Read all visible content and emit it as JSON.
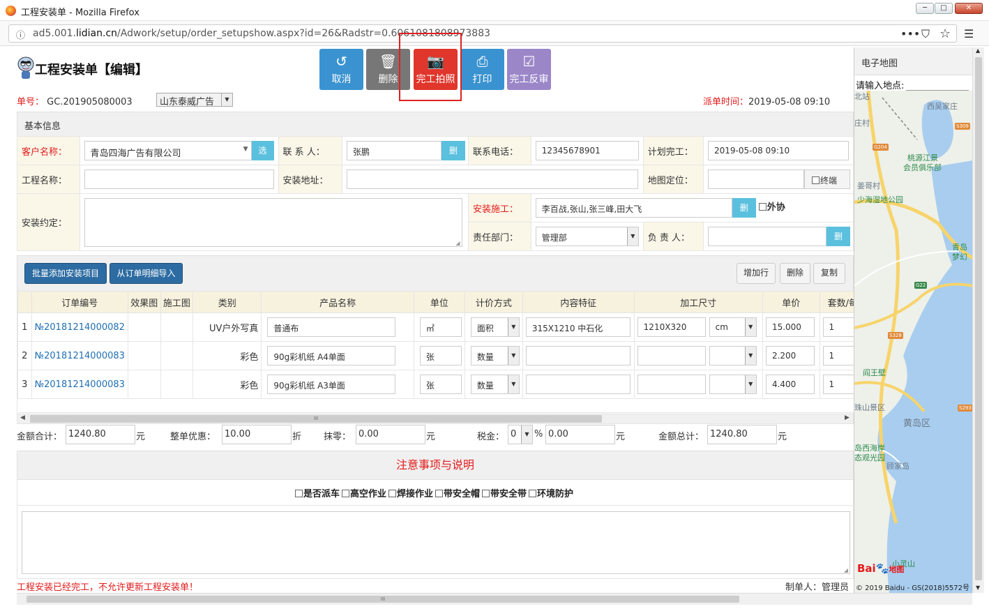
{
  "window": {
    "title": "工程安装单 - Mozilla Firefox",
    "url_prefix": "ad5.001.",
    "url_domain": "lidian.cn",
    "url_path": "/Adwork/setup/order_setupshow.aspx?id=26&Radstr=0.6061081808973883",
    "min_label": "─",
    "max_label": "□",
    "close_label": "✕",
    "menu_dots": "•••",
    "star": "☆",
    "hamburger": "☰",
    "pocket": "⛉"
  },
  "header": {
    "title": "工程安装单【编辑】",
    "order_label": "单号：",
    "order_no": "GC.201905080003",
    "company": "山东泰威广告",
    "dispatch_label": "派单时间：",
    "dispatch_time": "2019-05-08 09:10"
  },
  "toolbar": [
    {
      "label": "取消",
      "icon": "undo-icon",
      "glyph": "↺",
      "color": "#3a93d0"
    },
    {
      "label": "删除",
      "icon": "trash-icon",
      "glyph": "🗑",
      "color": "#777777"
    },
    {
      "label": "完工拍照",
      "icon": "camera-icon",
      "glyph": "📷",
      "color": "#e0362b"
    },
    {
      "label": "打印",
      "icon": "printer-icon",
      "glyph": "⎙",
      "color": "#3a93d0"
    },
    {
      "label": "完工反审",
      "icon": "check-square-icon",
      "glyph": "☑",
      "color": "#9b86c8"
    }
  ],
  "basic": {
    "section_title": "基本信息",
    "customer_label": "客户名称：",
    "customer_value": "青岛四海广告有限公司",
    "select_button": "选",
    "contact_label": "联 系 人：",
    "contact_value": "张鹏",
    "delete_button": "删",
    "phone_label": "联系电话：",
    "phone_value": "12345678901",
    "plan_label": "计划完工：",
    "plan_value": "2019-05-08 09:10",
    "project_label": "工程名称：",
    "project_value": "",
    "address_label": "安装地址：",
    "address_value": "",
    "geo_label": "地图定位：",
    "geo_value": "",
    "terminal_label": "终端",
    "agreement_label": "安装约定：",
    "installer_label": "安装施工：",
    "installer_value": "李百战,张山,张三峰,田大飞",
    "outsource_label": "外协",
    "dept_label": "责任部门：",
    "dept_value": "管理部",
    "owner_label": "负 责 人：",
    "owner_value": ""
  },
  "items": {
    "batch_button": "批量添加安装项目",
    "import_button": "从订单明细导入",
    "add_row_button": "增加行",
    "delete_button": "删除",
    "copy_button": "复制",
    "columns": [
      "",
      "订单编号",
      "效果图",
      "施工图",
      "类别",
      "产品名称",
      "单位",
      "计价方式",
      "内容特征",
      "加工尺寸",
      "单价",
      "套数/每套"
    ],
    "rows": [
      {
        "no": "1",
        "order": "№20181214000082",
        "category": "UV户外写真",
        "product": "普通布",
        "unit": "㎡",
        "pricing": "面积",
        "feature": "315X1210 中石化",
        "size": "1210X320",
        "size_unit": "cm",
        "price": "15.000",
        "qty": "1",
        "x": "X"
      },
      {
        "no": "2",
        "order": "№20181214000083",
        "category": "彩色",
        "product": "90g彩机纸 A4单面",
        "unit": "张",
        "pricing": "数量",
        "feature": "",
        "size": "",
        "size_unit": "",
        "price": "2.200",
        "qty": "1",
        "x": "X"
      },
      {
        "no": "3",
        "order": "№20181214000083",
        "category": "彩色",
        "product": "90g彩机纸 A3单面",
        "unit": "张",
        "pricing": "数量",
        "feature": "",
        "size": "",
        "size_unit": "",
        "price": "4.400",
        "qty": "1",
        "x": "X"
      }
    ],
    "scroll_grip": "III"
  },
  "totals": {
    "sum_label": "金额合计：",
    "sum_value": "1240.80",
    "yuan": "元",
    "discount_label": "整单优惠：",
    "discount_value": "10.00",
    "discount_unit": "折",
    "rounding_label": "抹零：",
    "rounding_value": "0.00",
    "tax_label": "税金：",
    "tax_rate": "0",
    "percent": "%",
    "tax_value": "0.00",
    "total_label": "金额总计：",
    "total_value": "1240.80"
  },
  "notes": {
    "title": "注意事项与说明",
    "options": [
      "是否派车",
      "高空作业",
      "焊接作业",
      "带安全帽",
      "带安全带",
      "环境防护"
    ]
  },
  "footer": {
    "warning": "工程安装已经完工，不允许更新工程安装单！",
    "maker": "制单人：管理员"
  },
  "map": {
    "title": "电子地图",
    "search_label": "请输入地点:",
    "labels": [
      "北站",
      "西吴家庄",
      "庄村",
      "桃源江景",
      "会员俱乐部",
      "姜哥村",
      "少海湿地公园",
      "青岛",
      "梦幻",
      "阎王壁",
      "珠山景区",
      "黄岛区",
      "岛西海岸",
      "态观光园",
      "顾家岛",
      "小灵山"
    ],
    "shields": [
      "S309",
      "G204",
      "G22",
      "S328",
      "S293"
    ],
    "logo": "Bai",
    "logo2": "地图",
    "copyright": "© 2019 Baidu - GS(2018)5572号 -"
  }
}
